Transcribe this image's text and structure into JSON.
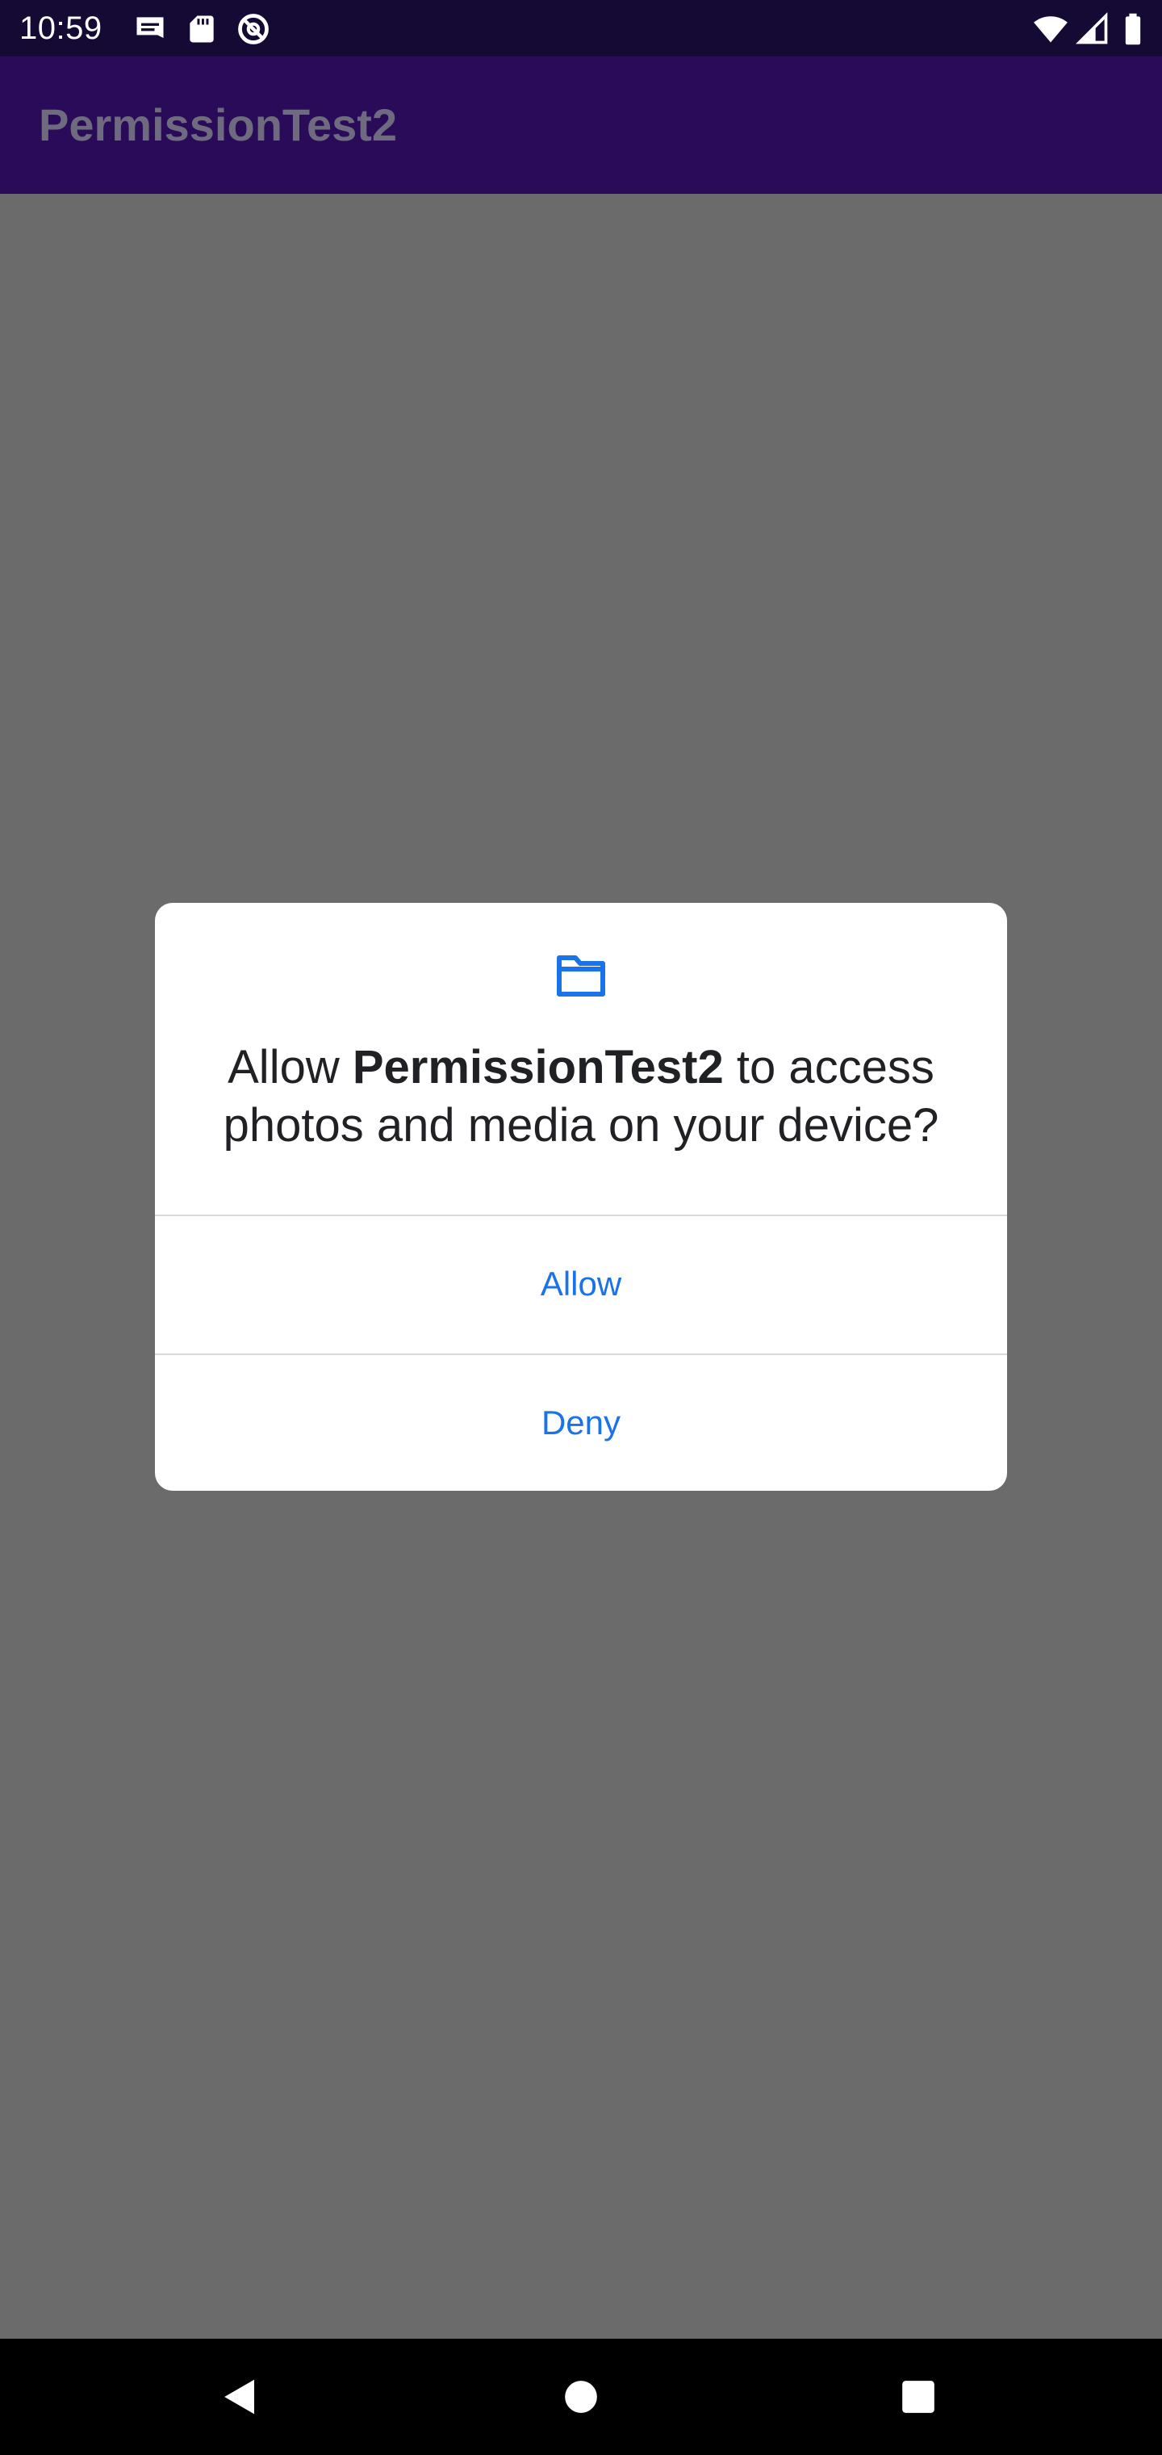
{
  "status_bar": {
    "time": "10:59",
    "left_icons": [
      "notification-message-icon",
      "sd-card-icon",
      "no-disturb-icon"
    ],
    "right_icons": [
      "wifi-icon",
      "cell-signal-icon",
      "battery-icon"
    ]
  },
  "app_bar": {
    "title": "PermissionTest2"
  },
  "dialog": {
    "icon": "folder-icon",
    "message_prefix": "Allow ",
    "app_name": "PermissionTest2",
    "message_suffix": " to access photos and media on your device?",
    "allow_label": "Allow",
    "deny_label": "Deny"
  },
  "nav_bar": {
    "buttons": [
      "back-icon",
      "home-icon",
      "recents-icon"
    ]
  },
  "colors": {
    "status_bar": "#150a33",
    "app_bar": "#2a0b5a",
    "scrim": "#6b6b6b",
    "dialog_accent": "#1a73e8"
  }
}
